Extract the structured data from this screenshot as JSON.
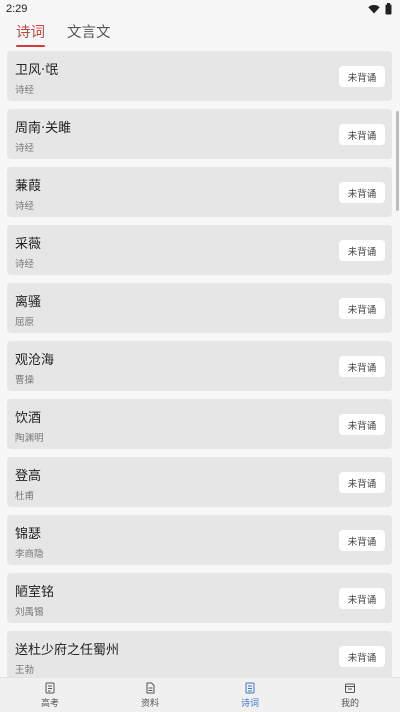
{
  "status_bar": {
    "time": "2:29"
  },
  "tabs": [
    {
      "label": "诗词",
      "active": true
    },
    {
      "label": "文言文",
      "active": false
    }
  ],
  "poems": [
    {
      "title": "卫风·氓",
      "author": "诗经",
      "status": "未背诵"
    },
    {
      "title": "周南·关雎",
      "author": "诗经",
      "status": "未背诵"
    },
    {
      "title": "蒹葭",
      "author": "诗经",
      "status": "未背诵"
    },
    {
      "title": "采薇",
      "author": "诗经",
      "status": "未背诵"
    },
    {
      "title": "离骚",
      "author": "屈原",
      "status": "未背诵"
    },
    {
      "title": "观沧海",
      "author": "曹操",
      "status": "未背诵"
    },
    {
      "title": "饮酒",
      "author": "陶渊明",
      "status": "未背诵"
    },
    {
      "title": "登高",
      "author": "杜甫",
      "status": "未背诵"
    },
    {
      "title": "锦瑟",
      "author": "李商隐",
      "status": "未背诵"
    },
    {
      "title": "陋室铭",
      "author": "刘禹锡",
      "status": "未背诵"
    },
    {
      "title": "送杜少府之任蜀州",
      "author": "王勃",
      "status": "未背诵"
    }
  ],
  "bottom_nav": [
    {
      "label": "高考",
      "icon": "exam-icon",
      "active": false
    },
    {
      "label": "资料",
      "icon": "document-icon",
      "active": false
    },
    {
      "label": "诗词",
      "icon": "poem-icon",
      "active": true
    },
    {
      "label": "我的",
      "icon": "profile-icon",
      "active": false
    }
  ],
  "colors": {
    "accent": "#d63b3b",
    "nav_active": "#3a78c9",
    "card_bg": "#e6e6e6"
  }
}
